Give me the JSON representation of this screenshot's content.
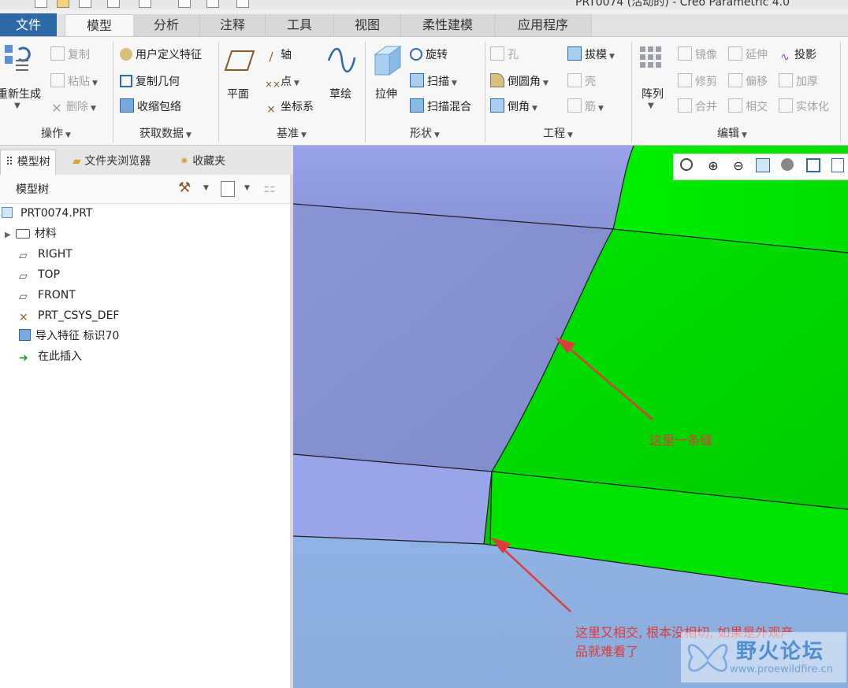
{
  "window": {
    "title_fragment": "PRT0074 (活动的) - Creo Parametric 4.0"
  },
  "tabs": [
    {
      "label": "文件"
    },
    {
      "label": "模型"
    },
    {
      "label": "分析"
    },
    {
      "label": "注释"
    },
    {
      "label": "工具"
    },
    {
      "label": "视图"
    },
    {
      "label": "柔性建模"
    },
    {
      "label": "应用程序"
    }
  ],
  "ribbon": {
    "operations": {
      "regenerate": "重新生成",
      "copy": "复制",
      "paste": "粘贴",
      "delete": "删除",
      "group": "操作"
    },
    "get_data": {
      "udf": "用户定义特征",
      "copy_geom": "复制几何",
      "shrinkwrap": "收缩包络",
      "group": "获取数据"
    },
    "datum": {
      "plane": "平面",
      "axis": "轴",
      "point": "点",
      "csys": "坐标系",
      "sketch": "草绘",
      "group": "基准"
    },
    "shapes": {
      "extrude": "拉伸",
      "revolve": "旋转",
      "sweep": "扫描",
      "swept_blend": "扫描混合",
      "group": "形状"
    },
    "engineering": {
      "hole": "孔",
      "draft": "拔模",
      "round": "倒圆角",
      "shell": "壳",
      "chamfer": "倒角",
      "rib": "筋",
      "group": "工程"
    },
    "editing": {
      "pattern": "阵列",
      "mirror": "镜像",
      "extend": "延伸",
      "project": "投影",
      "trim": "修剪",
      "offset": "偏移",
      "thicken": "加厚",
      "merge": "合并",
      "intersect": "相交",
      "solidify": "实体化",
      "group": "编辑"
    }
  },
  "panel_tabs": [
    {
      "label": "模型树"
    },
    {
      "label": "文件夹浏览器"
    },
    {
      "label": "收藏夹"
    }
  ],
  "model_tree": {
    "header": "模型树",
    "items": [
      {
        "label": "PRT0074.PRT"
      },
      {
        "label": "材料"
      },
      {
        "label": "RIGHT"
      },
      {
        "label": "TOP"
      },
      {
        "label": "FRONT"
      },
      {
        "label": "PRT_CSYS_DEF"
      },
      {
        "label": "导入特征 标识70"
      },
      {
        "label": "在此插入"
      }
    ]
  },
  "annotations": {
    "seam_note": "这里一条缝",
    "intersect_note_line1": "这里又相交, 根本没相切, 如果是外观产",
    "intersect_note_line2": "品就难看了"
  },
  "watermark": {
    "title": "野火论坛",
    "url": "www.proewildfire.cn"
  },
  "colors": {
    "accent": "#2e6aa8",
    "surface_blue": "#8e96da",
    "surface_green": "#00e000",
    "annotation_red": "#e03a3a"
  }
}
